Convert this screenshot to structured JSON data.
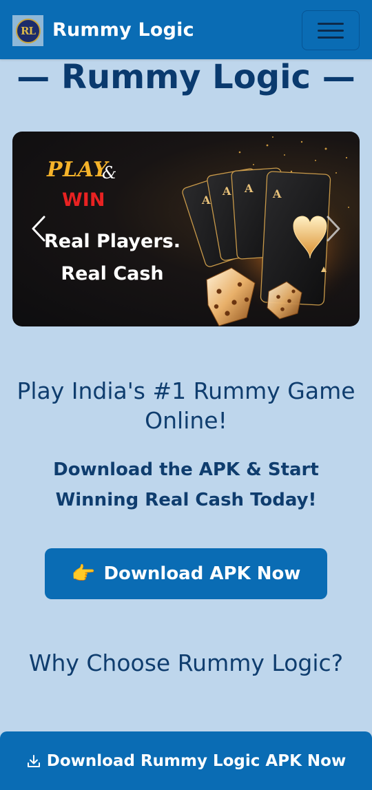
{
  "navbar": {
    "brand_name": "Rummy Logic",
    "logo_icon": "rummy-logic-logo",
    "logo_monogram": "RL",
    "menu_icon": "hamburger-menu-icon",
    "color": "#0a6cb4"
  },
  "page": {
    "heading": "— Rummy Logic —",
    "background": "#bed6ec"
  },
  "carousel": {
    "play": "PLAY",
    "ampersand": "&",
    "win": "WIN",
    "line1": "Real Players.",
    "line2": "Real Cash",
    "prev_icon": "chevron-left-icon",
    "next_icon": "chevron-right-icon"
  },
  "intro": {
    "title": "Play India's #1 Rummy Game Online!",
    "subtitle": "Download the APK & Start Winning Real Cash Today!"
  },
  "cta": {
    "emoji": "👉",
    "label": "Download APK Now"
  },
  "why": {
    "heading": "Why Choose Rummy Logic?"
  },
  "sticky_bar": {
    "icon": "download-icon",
    "label": "Download Rummy Logic APK Now"
  }
}
